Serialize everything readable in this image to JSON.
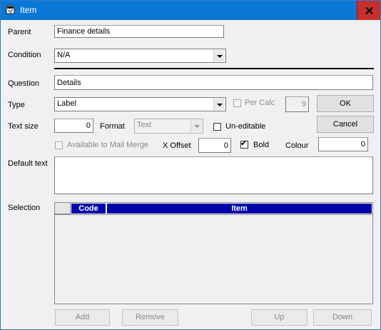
{
  "window": {
    "title": "Item"
  },
  "labels": {
    "parent": "Parent",
    "condition": "Condition",
    "question": "Question",
    "type": "Type",
    "text_size": "Text size",
    "format": "Format",
    "default_text": "Default text",
    "selection": "Selection",
    "x_offset": "X Offset",
    "colour": "Colour"
  },
  "fields": {
    "parent": "Finance details",
    "condition": "N/A",
    "question": "Details",
    "type": "Label",
    "text_size": "0",
    "format": "Text",
    "per_calc_value": "9",
    "x_offset": "0",
    "colour": "0",
    "default_text": ""
  },
  "checkboxes": {
    "per_calc": {
      "label": "Per Calc",
      "checked": false,
      "enabled": false
    },
    "un_editable": {
      "label": "Un-editable",
      "checked": false,
      "enabled": true
    },
    "mail_merge": {
      "label": "Available to Mail Merge",
      "checked": false,
      "enabled": false
    },
    "bold": {
      "label": "Bold",
      "checked": true,
      "enabled": true,
      "mark": "✔"
    }
  },
  "buttons": {
    "ok": "OK",
    "cancel": "Cancel",
    "add": "Add",
    "remove": "Remove",
    "up": "Up",
    "down": "Down"
  },
  "grid": {
    "columns": [
      "Code",
      "Item"
    ],
    "rows": []
  },
  "colors": {
    "titlebar": "#0b78d7",
    "close": "#c7302a",
    "grid_header": "#0000a8"
  }
}
